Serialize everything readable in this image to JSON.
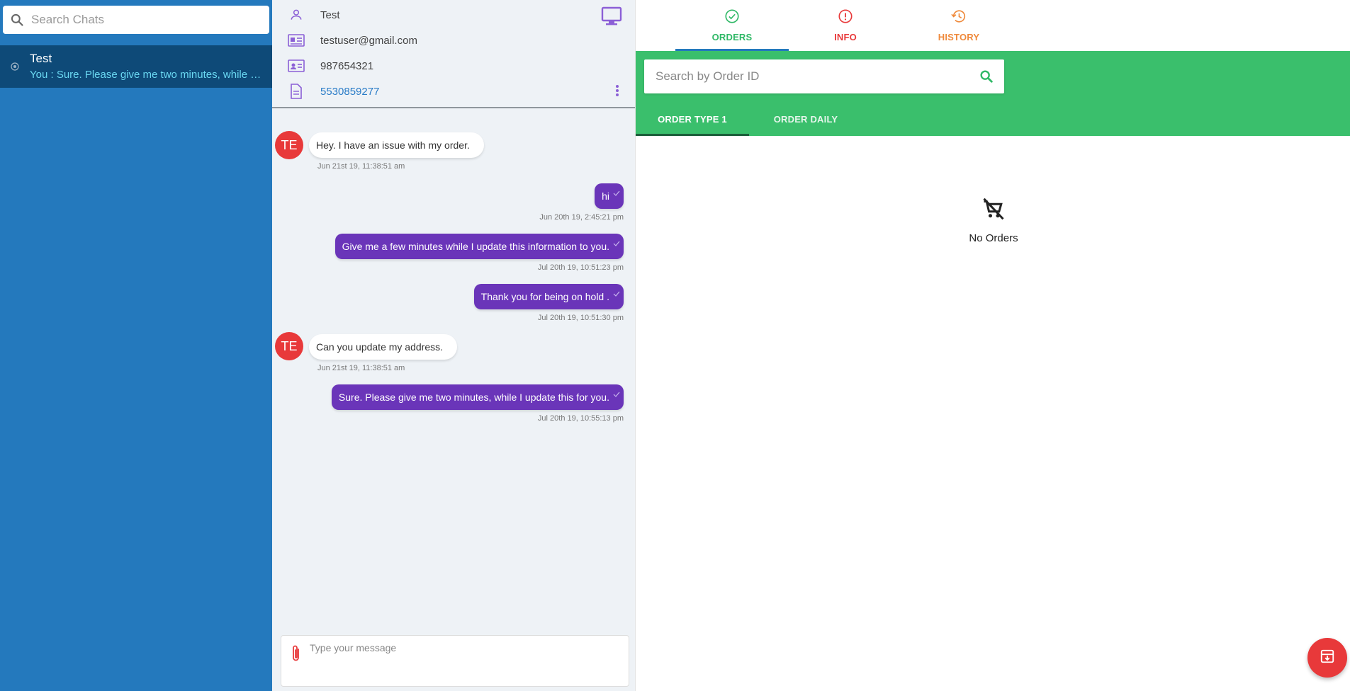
{
  "sidebar": {
    "search_placeholder": "Search Chats",
    "chats": [
      {
        "name": "Test",
        "preview": "You : Sure. Please give me two minutes, while I update this for you."
      }
    ]
  },
  "contact": {
    "name": "Test",
    "email": "testuser@gmail.com",
    "phone": "987654321",
    "order_ref": "5530859277"
  },
  "messages": [
    {
      "direction": "in",
      "avatar": "TE",
      "text": "Hey. I have an issue with my order.",
      "time": "Jun 21st 19, 11:38:51 am"
    },
    {
      "direction": "out",
      "text": "hi",
      "time": "Jun 20th 19, 2:45:21 pm"
    },
    {
      "direction": "out",
      "text": "Give me a few minutes while I update this information to you.",
      "time": "Jul 20th 19, 10:51:23 pm"
    },
    {
      "direction": "out",
      "text": "Thank you for being on hold .",
      "time": "Jul 20th 19, 10:51:30 pm"
    },
    {
      "direction": "in",
      "avatar": "TE",
      "text": "Can you update my address.",
      "time": "Jun 21st 19, 11:38:51 am"
    },
    {
      "direction": "out",
      "text": "Sure. Please give me two minutes, while I update this for you.",
      "time": "Jul 20th 19, 10:55:13 pm"
    }
  ],
  "composer": {
    "placeholder": "Type your message"
  },
  "right_panel": {
    "tabs": [
      {
        "label": "ORDERS",
        "icon": "check-circle-icon",
        "color": "#2fb866"
      },
      {
        "label": "INFO",
        "icon": "info-circle-icon",
        "color": "#e8393a"
      },
      {
        "label": "HISTORY",
        "icon": "history-icon",
        "color": "#ef8a3c"
      }
    ],
    "search_placeholder": "Search by Order ID",
    "sub_tabs": [
      {
        "label": "ORDER TYPE 1"
      },
      {
        "label": "ORDER DAILY"
      }
    ],
    "empty_text": "No Orders"
  },
  "colors": {
    "sidebar": "#2479bd",
    "selected_chat": "#0e4a78",
    "outgoing_bubble": "#6a35b9",
    "avatar": "#e8393a",
    "green_bar": "#3abf6c",
    "icon_purple": "#8b5fd6"
  }
}
